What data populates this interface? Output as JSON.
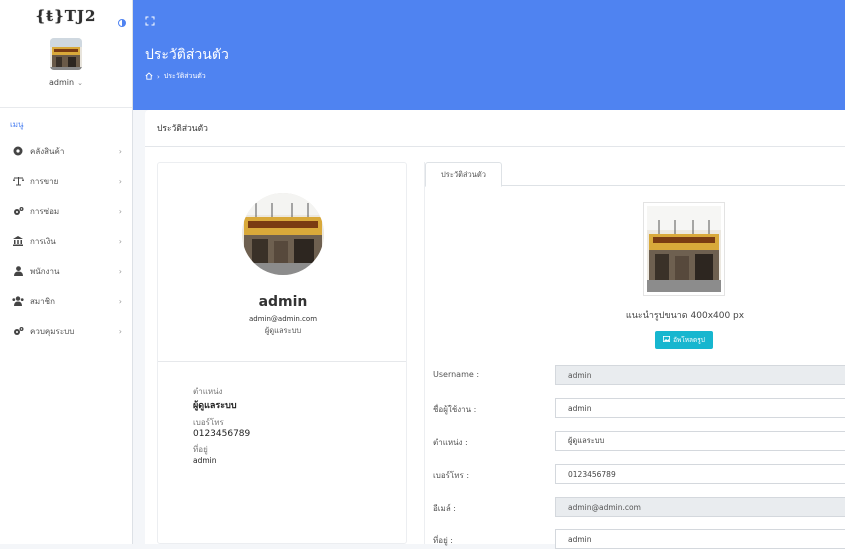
{
  "app": {
    "logo_text": "{ŧ}TJ2"
  },
  "sidebar": {
    "username": "admin",
    "menu_heading": "เมนู",
    "items": [
      {
        "label": "คลังสินค้า",
        "icon": "warehouse-icon"
      },
      {
        "label": "การขาย",
        "icon": "scale-icon"
      },
      {
        "label": "การซ่อม",
        "icon": "gears-icon"
      },
      {
        "label": "การเงิน",
        "icon": "bank-icon"
      },
      {
        "label": "พนักงาน",
        "icon": "user-icon"
      },
      {
        "label": "สมาชิก",
        "icon": "users-icon"
      },
      {
        "label": "ควบคุมระบบ",
        "icon": "gears-icon"
      }
    ]
  },
  "header": {
    "title": "ประวัติส่วนตัว",
    "breadcrumb": {
      "current": "ประวัติส่วนตัว"
    }
  },
  "card": {
    "title": "ประวัติส่วนตัว"
  },
  "profile": {
    "name": "admin",
    "email": "admin@admin.com",
    "role": "ผู้ดูแลระบบ",
    "fields": {
      "position_label": "ตำแหน่ง",
      "position_value": "ผู้ดูแลระบบ",
      "phone_label": "เบอร์โทร",
      "phone_value": "0123456789",
      "address_label": "ที่อยู่",
      "address_value": "admin"
    }
  },
  "form": {
    "tab_label": "ประวัติส่วนตัว",
    "size_hint": "แนะนำรูปขนาด 400x400 px",
    "upload_label": "อัพโหลดรูป",
    "rows": [
      {
        "label": "Username :",
        "value": "admin",
        "readonly": true
      },
      {
        "label": "ชื่อผู้ใช้งาน :",
        "value": "admin",
        "readonly": false
      },
      {
        "label": "ตำแหน่ง :",
        "value": "ผู้ดูแลระบบ",
        "readonly": false
      },
      {
        "label": "เบอร์โทร :",
        "value": "0123456789",
        "readonly": false
      },
      {
        "label": "อีเมล์ :",
        "value": "admin@admin.com",
        "readonly": true
      },
      {
        "label": "ที่อยู่ :",
        "value": "admin",
        "readonly": false
      }
    ]
  },
  "colors": {
    "accent": "#4f83f1",
    "button": "#17b6cf",
    "readonly_bg": "#e9ecef"
  }
}
